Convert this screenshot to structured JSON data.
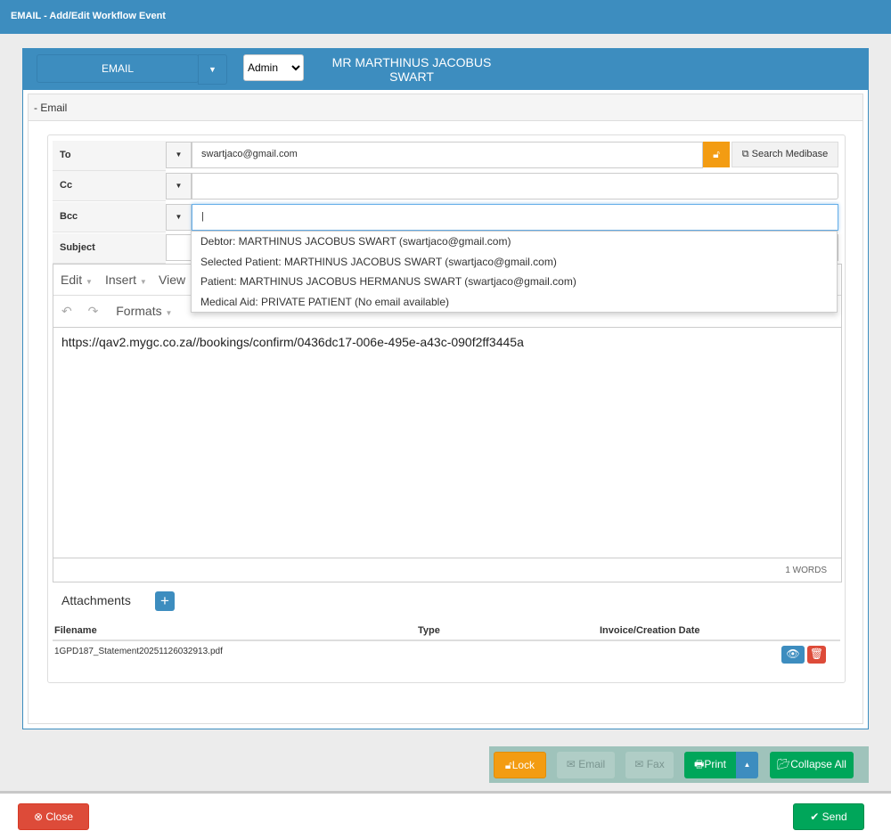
{
  "window": {
    "title": "EMAIL - Add/Edit Workflow Event"
  },
  "header": {
    "type_label": "EMAIL",
    "role_select": "Admin",
    "patient_name_line1": "MR MARTHINUS JACOBUS",
    "patient_name_line2": "SWART"
  },
  "section": {
    "title": "- Email"
  },
  "fields": {
    "to_label": "To",
    "to_value": "swartjaco@gmail.com",
    "cc_label": "Cc",
    "cc_value": "",
    "bcc_label": "Bcc",
    "bcc_value": "",
    "subject_label": "Subject",
    "search_label": "Search Medibase"
  },
  "dropdown": [
    "Debtor: MARTHINUS JACOBUS SWART (swartjaco@gmail.com)",
    "Selected Patient: MARTHINUS JACOBUS SWART (swartjaco@gmail.com)",
    "Patient: MARTHINUS JACOBUS HERMANUS SWART (swartjaco@gmail.com)",
    "Medical Aid: PRIVATE PATIENT (No email available)"
  ],
  "editor": {
    "menu": [
      "Edit",
      "Insert",
      "View"
    ],
    "formats": "Formats",
    "content": "https://qav2.mygc.co.za//bookings/confirm/0436dc17-006e-495e-a43c-090f2ff3445a",
    "word_count": "1 WORDS"
  },
  "attachments": {
    "title": "Attachments",
    "columns": [
      "Filename",
      "Type",
      "Invoice/Creation Date"
    ],
    "rows": [
      {
        "filename": "1GPD187_Statement20251126032913.pdf",
        "type": "",
        "date": ""
      }
    ]
  },
  "actions": {
    "lock": "Lock",
    "email": "Email",
    "fax": "Fax",
    "print": "Print",
    "collapse": "Collapse All"
  },
  "footer": {
    "close": "Close",
    "send": "Send"
  },
  "colors": {
    "primary": "#3d8dbf",
    "success": "#00a65a",
    "warning": "#f39c12",
    "danger": "#dd4b39"
  }
}
